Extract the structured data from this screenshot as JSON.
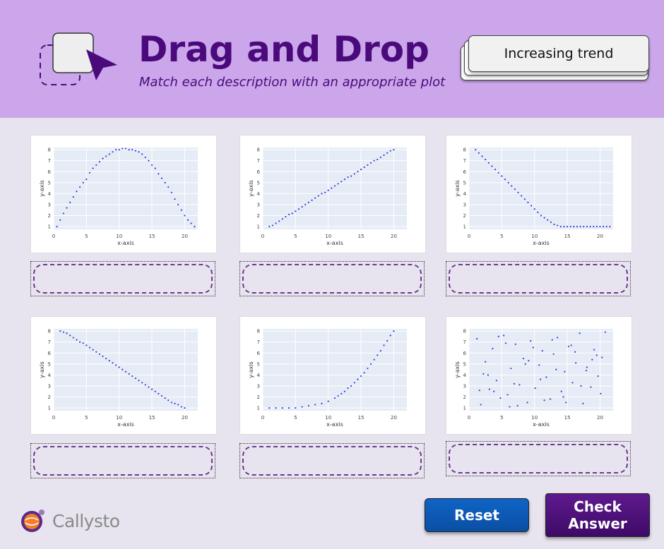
{
  "header": {
    "title": "Drag and Drop",
    "subtitle": "Match each description with an appropriate plot"
  },
  "draggable_card": {
    "label": "Increasing trend"
  },
  "buttons": {
    "reset": "Reset",
    "check_line1": "Check",
    "check_line2": "Answer"
  },
  "brand": {
    "name": "Callysto"
  },
  "colors": {
    "header_bg": "#cba6ea",
    "title": "#4b0a7c",
    "point": "#3b3bd6",
    "plot_bg": "#e5ecf6"
  },
  "chart_data": [
    {
      "type": "scatter",
      "xlabel": "x-axis",
      "ylabel": "y-axis",
      "xlim": [
        0,
        22
      ],
      "ylim": [
        1,
        8
      ],
      "xticks": [
        "0",
        "5",
        "10",
        "15",
        "20"
      ],
      "yticks": [
        "1",
        "2",
        "3",
        "4",
        "5",
        "6",
        "7",
        "8"
      ],
      "x": [
        0.5,
        1,
        1.5,
        2,
        2.5,
        3,
        3.5,
        4,
        4.5,
        5,
        5.5,
        6,
        6.5,
        7,
        7.5,
        8,
        8.5,
        9,
        9.5,
        10,
        10.5,
        11,
        11.5,
        12,
        12.5,
        13,
        13.5,
        14,
        14.5,
        15,
        15.5,
        16,
        16.5,
        17,
        17.5,
        18,
        18.5,
        19,
        19.5,
        20,
        20.5,
        21,
        21.5
      ],
      "y": [
        1,
        1.6,
        2.2,
        2.7,
        3.2,
        3.7,
        4.2,
        4.6,
        5,
        5.3,
        5.9,
        6.3,
        6.6,
        6.9,
        7.2,
        7.4,
        7.6,
        7.8,
        8,
        8,
        8.1,
        8.1,
        8,
        8,
        7.9,
        7.8,
        7.6,
        7.3,
        7,
        6.6,
        6.3,
        5.8,
        5.4,
        5,
        4.6,
        4.1,
        3.5,
        3,
        2.5,
        2,
        1.6,
        1.3,
        1
      ]
    },
    {
      "type": "scatter",
      "xlabel": "x-axis",
      "ylabel": "y-axis",
      "xlim": [
        0,
        22
      ],
      "ylim": [
        1,
        8
      ],
      "xticks": [
        "0",
        "5",
        "10",
        "15",
        "20"
      ],
      "yticks": [
        "1",
        "2",
        "3",
        "4",
        "5",
        "6",
        "7",
        "8"
      ],
      "x": [
        1,
        1.5,
        2,
        2.5,
        3,
        3.5,
        4,
        4.5,
        5,
        5.5,
        6,
        6.5,
        7,
        7.5,
        8,
        8.5,
        9,
        9.5,
        10,
        10.5,
        11,
        11.5,
        12,
        12.5,
        13,
        13.5,
        14,
        14.5,
        15,
        15.5,
        16,
        16.5,
        17,
        17.5,
        18,
        18.5,
        19,
        19.5,
        20
      ],
      "y": [
        1,
        1.1,
        1.3,
        1.5,
        1.7,
        1.9,
        2.1,
        2.2,
        2.4,
        2.6,
        2.8,
        3,
        3.2,
        3.4,
        3.6,
        3.8,
        4,
        4.1,
        4.3,
        4.5,
        4.7,
        4.9,
        5.1,
        5.3,
        5.5,
        5.6,
        5.8,
        6,
        6.2,
        6.4,
        6.6,
        6.8,
        7,
        7.1,
        7.3,
        7.5,
        7.7,
        7.9,
        8
      ]
    },
    {
      "type": "scatter",
      "xlabel": "x-axis",
      "ylabel": "y-axis",
      "xlim": [
        0,
        22
      ],
      "ylim": [
        1,
        8
      ],
      "xticks": [
        "0",
        "5",
        "10",
        "15",
        "20"
      ],
      "yticks": [
        "1",
        "2",
        "3",
        "4",
        "5",
        "6",
        "7",
        "8"
      ],
      "x": [
        1,
        1.5,
        2,
        2.5,
        3,
        3.5,
        4,
        4.5,
        5,
        5.5,
        6,
        6.5,
        7,
        7.5,
        8,
        8.5,
        9,
        9.5,
        10,
        10.5,
        11,
        11.5,
        12,
        12.5,
        13,
        13.5,
        14,
        14.5,
        15,
        15.5,
        16,
        16.5,
        17,
        17.5,
        18,
        18.5,
        19,
        19.5,
        20,
        20.5,
        21,
        21.5
      ],
      "y": [
        8,
        7.7,
        7.4,
        7.1,
        6.8,
        6.5,
        6.2,
        5.9,
        5.6,
        5.3,
        5,
        4.7,
        4.4,
        4.1,
        3.8,
        3.5,
        3.2,
        2.9,
        2.6,
        2.3,
        2.0,
        1.8,
        1.6,
        1.4,
        1.2,
        1.1,
        1,
        1,
        1,
        1,
        1,
        1,
        1,
        1,
        1,
        1,
        1,
        1,
        1,
        1,
        1,
        1
      ]
    },
    {
      "type": "scatter",
      "xlabel": "x-axis",
      "ylabel": "y-axis",
      "xlim": [
        0,
        22
      ],
      "ylim": [
        1,
        8
      ],
      "xticks": [
        "0",
        "5",
        "10",
        "15",
        "20"
      ],
      "yticks": [
        "1",
        "2",
        "3",
        "4",
        "5",
        "6",
        "7",
        "8"
      ],
      "x": [
        1,
        1.5,
        2,
        2.5,
        3,
        3.5,
        4,
        4.5,
        5,
        5.5,
        6,
        6.5,
        7,
        7.5,
        8,
        8.5,
        9,
        9.5,
        10,
        10.5,
        11,
        11.5,
        12,
        12.5,
        13,
        13.5,
        14,
        14.5,
        15,
        15.5,
        16,
        16.5,
        17,
        17.5,
        18,
        18.5,
        19,
        19.5,
        20
      ],
      "y": [
        8,
        7.9,
        7.8,
        7.6,
        7.4,
        7.2,
        7,
        6.9,
        6.7,
        6.5,
        6.3,
        6.1,
        5.9,
        5.7,
        5.5,
        5.3,
        5.1,
        4.9,
        4.7,
        4.5,
        4.3,
        4.1,
        3.9,
        3.7,
        3.5,
        3.3,
        3.1,
        2.9,
        2.7,
        2.5,
        2.3,
        2.1,
        1.9,
        1.7,
        1.5,
        1.4,
        1.3,
        1.1,
        1
      ]
    },
    {
      "type": "scatter",
      "xlabel": "x-axis",
      "ylabel": "y-axis",
      "xlim": [
        0,
        22
      ],
      "ylim": [
        1,
        8
      ],
      "xticks": [
        "0",
        "5",
        "10",
        "15",
        "20"
      ],
      "yticks": [
        "1",
        "2",
        "3",
        "4",
        "5",
        "6",
        "7",
        "8"
      ],
      "x": [
        1,
        2,
        3,
        4,
        5,
        6,
        7,
        8,
        9,
        10,
        11,
        11.5,
        12,
        12.5,
        13,
        13.5,
        14,
        14.5,
        15,
        15.5,
        16,
        16.5,
        17,
        17.5,
        18,
        18.5,
        19,
        19.5,
        20
      ],
      "y": [
        1,
        1,
        1,
        1,
        1,
        1.1,
        1.2,
        1.3,
        1.4,
        1.6,
        1.9,
        2.1,
        2.3,
        2.5,
        2.8,
        3,
        3.3,
        3.6,
        3.9,
        4.2,
        4.6,
        5,
        5.4,
        5.8,
        6.2,
        6.7,
        7.1,
        7.6,
        8
      ]
    },
    {
      "type": "scatter",
      "xlabel": "x-axis",
      "ylabel": "y-axis",
      "xlim": [
        0,
        22
      ],
      "ylim": [
        1,
        8
      ],
      "xticks": [
        "0",
        "5",
        "10",
        "15",
        "20"
      ],
      "yticks": [
        "1",
        "2",
        "3",
        "4",
        "5",
        "6",
        "7",
        "8"
      ],
      "x": [
        1.2,
        1.8,
        2.5,
        3.1,
        3.6,
        4.2,
        4.8,
        5.3,
        5.9,
        6.4,
        7.1,
        7.7,
        8.3,
        8.9,
        9.4,
        10.1,
        10.7,
        11.2,
        11.8,
        12.4,
        12.9,
        13.5,
        14.1,
        14.6,
        15.2,
        15.8,
        16.3,
        16.9,
        17.4,
        18,
        18.6,
        19.1,
        19.7,
        20.3,
        20.8,
        2.2,
        3.8,
        5.6,
        7.4,
        9.1,
        10.9,
        12.7,
        14.4,
        16.2,
        17.9,
        19.5,
        1.6,
        4.5,
        6.9,
        8.6,
        11.5,
        13.3,
        15.6,
        17.1,
        18.8,
        20.1,
        2.9,
        6.2,
        9.8,
        14.8
      ],
      "y": [
        7.3,
        1.3,
        5.2,
        2.7,
        6.4,
        3.5,
        1.9,
        7.6,
        2.2,
        4.6,
        6.8,
        3.1,
        5.5,
        1.5,
        7.1,
        2.8,
        4.9,
        6.2,
        3.8,
        1.8,
        5.9,
        7.4,
        2.5,
        4.3,
        6.6,
        3.3,
        5.1,
        7.8,
        1.4,
        4.7,
        2.9,
        6.3,
        3.9,
        5.6,
        7.9,
        4.1,
        2.5,
        6.9,
        1.2,
        5.3,
        3.6,
        7.2,
        2.0,
        6.1,
        4.4,
        5.8,
        2.6,
        7.5,
        3.2,
        5.0,
        1.7,
        4.5,
        6.7,
        3.0,
        5.4,
        2.3,
        4.0,
        1.1,
        6.5,
        1.5
      ]
    }
  ]
}
